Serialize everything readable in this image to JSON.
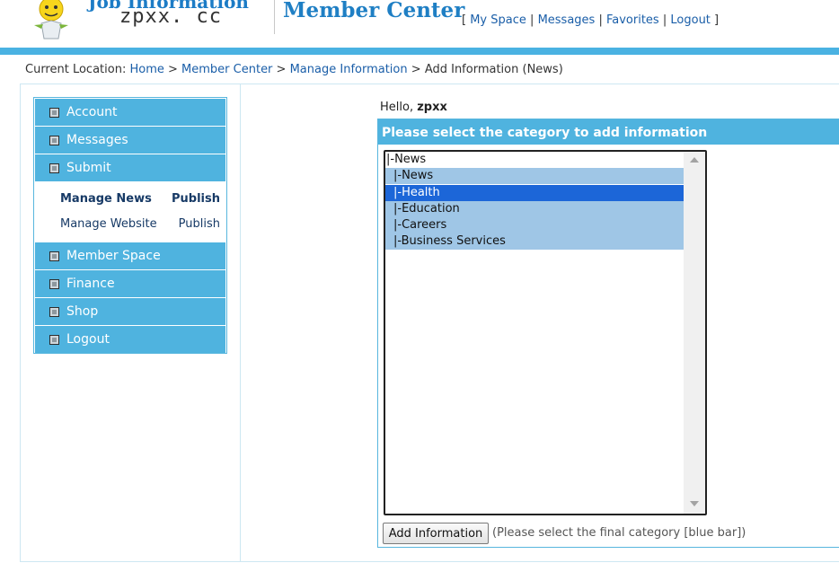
{
  "header": {
    "logo_tagline": "Job Information",
    "logo_site": "zpxx. cc",
    "title": "Member Center",
    "links": {
      "open_bracket": "[",
      "my_space": "My Space",
      "messages": "Messages",
      "favorites": "Favorites",
      "logout": "Logout",
      "separator": "|",
      "close_bracket": "]"
    }
  },
  "breadcrumb": {
    "prefix": "Current Location:",
    "sep": ">",
    "home": "Home",
    "member_center": "Member Center",
    "manage_information": "Manage Information",
    "current": "Add Information (News)"
  },
  "sidebar": {
    "items": [
      {
        "label": "Account"
      },
      {
        "label": "Messages"
      },
      {
        "label": "Submit"
      },
      {
        "label": "Member Space"
      },
      {
        "label": "Finance"
      },
      {
        "label": "Shop"
      },
      {
        "label": "Logout"
      }
    ],
    "submenu": [
      {
        "manage": "Manage News",
        "publish": "Publish",
        "active": true
      },
      {
        "manage": "Manage Website",
        "publish": "Publish",
        "active": false
      }
    ]
  },
  "main": {
    "greeting_prefix": "Hello,",
    "username": "zpxx",
    "panel_title": "Please select the category to add information",
    "categories": [
      {
        "label": "|-News",
        "level": 0
      },
      {
        "label": "|-News",
        "level": 1
      },
      {
        "label": "|-Health",
        "level": 1,
        "selected": true
      },
      {
        "label": "|-Education",
        "level": 1
      },
      {
        "label": "|-Careers",
        "level": 1
      },
      {
        "label": "|-Business Services",
        "level": 1
      }
    ],
    "add_button": "Add Information",
    "hint": "(Please select the final category [blue bar])"
  },
  "colors": {
    "accent": "#4fb3df",
    "selected": "#1c66d8",
    "child_highlight": "#9fc6e6",
    "link": "#1a5ea8"
  }
}
